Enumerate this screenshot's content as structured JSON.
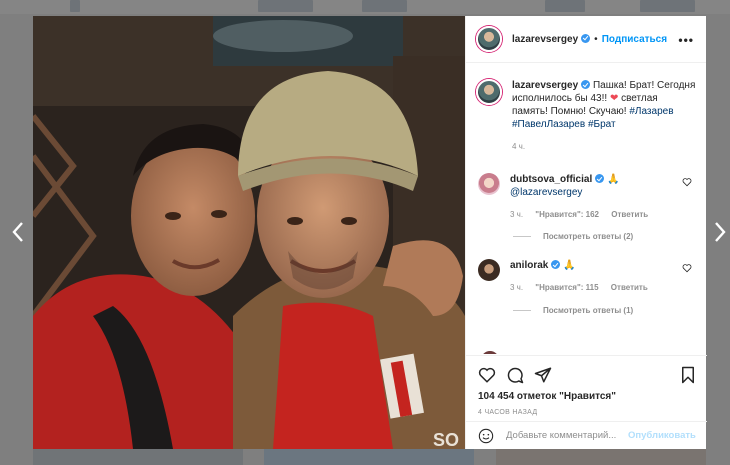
{
  "colors": {
    "link": "#0095f6",
    "verified": "#3897f0",
    "hashtag": "#00376b",
    "heart": "#ed4956",
    "muted": "#8e8e8e",
    "publish_disabled": "#b2dffc"
  },
  "header": {
    "username": "lazarevsergey",
    "separator": "•",
    "follow_label": "Подписаться",
    "more_label": "•••"
  },
  "caption": {
    "username": "lazarevsergey",
    "text_1": "Пашка! Брат! Сегодня исполнилось бы 43!!",
    "heart": "❤",
    "text_2": "светлая память! Помню! Скучаю!",
    "hashtags": "#Лазарев #ПавелЛазарев #Брат",
    "time": "4 ч."
  },
  "comments": [
    {
      "username": "dubtsova_official",
      "emoji": "🙏",
      "mention": "@lazarevsergey",
      "time": "3 ч.",
      "likes": "\"Нравится\": 162",
      "reply_label": "Ответить",
      "view_replies": "Посмотреть ответы (2)"
    },
    {
      "username": "anilorak",
      "emoji": "🙏",
      "time": "3 ч.",
      "likes": "\"Нравится\": 115",
      "reply_label": "Ответить",
      "view_replies": "Посмотреть ответы (1)"
    }
  ],
  "actions": {
    "likes_text": "104 454 отметок \"Нравится\"",
    "posted_ago": "4 ЧАСОВ НАЗАД"
  },
  "add_comment": {
    "placeholder": "Добавьте комментарий...",
    "publish_label": "Опубликовать"
  },
  "icons": [
    "chevron-left-icon",
    "chevron-right-icon",
    "heart-icon",
    "comment-icon",
    "share-icon",
    "bookmark-icon",
    "emoji-icon",
    "verified-badge-icon",
    "more-icon"
  ]
}
